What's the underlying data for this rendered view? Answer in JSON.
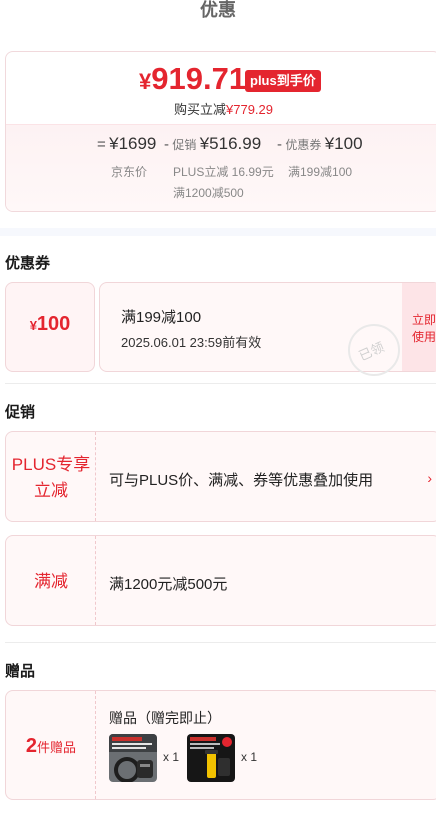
{
  "page": {
    "title": "优惠"
  },
  "price_card": {
    "currency": "¥",
    "final_price": "919.71",
    "badge": "plus到手价",
    "discount_prefix": "购买立减",
    "discount_amount": "¥779.29",
    "breakdown": [
      {
        "op": "=",
        "tag": "",
        "amount": "¥1699",
        "sub": [
          "京东价"
        ]
      },
      {
        "op": "-",
        "tag": "促销",
        "amount": "¥516.99",
        "sub": [
          "PLUS立减 16.99元",
          "满1200减500"
        ]
      },
      {
        "op": "-",
        "tag": "优惠券",
        "amount": "¥100",
        "sub": [
          "满199减100"
        ]
      }
    ]
  },
  "coupon_section": {
    "heading": "优惠券",
    "coupon": {
      "currency": "¥",
      "amount": "100",
      "condition": "满199减100",
      "validity": "2025.06.01 23:59前有效",
      "stamp": "已领",
      "use_button": "立即使用"
    }
  },
  "promo_section": {
    "heading": "促销",
    "items": [
      {
        "tag_lines": [
          "PLUS专享",
          "立减"
        ],
        "text": "可与PLUS价、满减、券等优惠叠加使用",
        "arrow": "›"
      },
      {
        "tag_lines": [
          "满减"
        ],
        "text": "满1200元减500元"
      }
    ]
  },
  "gift_section": {
    "heading": "赠品",
    "count": "2",
    "count_unit": "件赠品",
    "title": "赠品（赠完即止）",
    "items": [
      {
        "qty": "x 1"
      },
      {
        "qty": "x 1"
      }
    ]
  },
  "colors": {
    "accent": "#e4252f",
    "card_bg": "#fff8f8",
    "border": "#f1d6d9"
  }
}
